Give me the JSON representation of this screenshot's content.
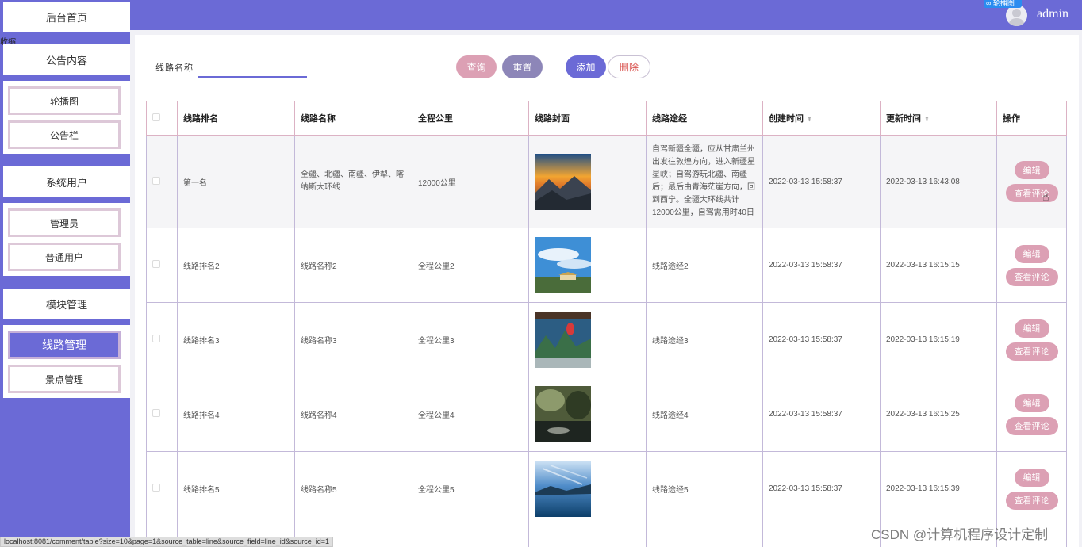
{
  "sidebar": {
    "home": "后台首页",
    "collapse": "收缩",
    "sections": [
      {
        "title": "公告内容",
        "items": [
          "轮播图",
          "公告栏"
        ]
      },
      {
        "title": "系统用户",
        "items": [
          "管理员",
          "普通用户"
        ]
      },
      {
        "title": "模块管理",
        "items": [
          "线路管理",
          "景点管理"
        ]
      }
    ],
    "active_item": "线路管理"
  },
  "header": {
    "username": "admin",
    "tray_badge": "∞ 轮播图"
  },
  "search": {
    "label": "线路名称",
    "placeholder": ""
  },
  "toolbar": {
    "query": "查询",
    "reset": "重置",
    "add": "添加",
    "delete": "删除"
  },
  "table": {
    "columns": [
      "线路排名",
      "线路名称",
      "全程公里",
      "线路封面",
      "线路途经",
      "创建时间",
      "更新时间",
      "操作"
    ],
    "rows": [
      {
        "rank": "第一名",
        "name": "全疆、北疆、南疆、伊犁、喀纳斯大环线",
        "distance": "12000公里",
        "route": "自驾新疆全疆，应从甘肃兰州出发往敦煌方向，进入新疆星星峡；自驾游玩北疆、南疆后；最后由青海茫崖方向，回到西宁。全疆大环线共计12000公里，自驾需用时40日",
        "created": "2022-03-13 15:58:37",
        "updated": "2022-03-13 16:43:08"
      },
      {
        "rank": "线路排名2",
        "name": "线路名称2",
        "distance": "全程公里2",
        "route": "线路途经2",
        "created": "2022-03-13 15:58:37",
        "updated": "2022-03-13 16:15:15"
      },
      {
        "rank": "线路排名3",
        "name": "线路名称3",
        "distance": "全程公里3",
        "route": "线路途经3",
        "created": "2022-03-13 15:58:37",
        "updated": "2022-03-13 16:15:19"
      },
      {
        "rank": "线路排名4",
        "name": "线路名称4",
        "distance": "全程公里4",
        "route": "线路途经4",
        "created": "2022-03-13 15:58:37",
        "updated": "2022-03-13 16:15:25"
      },
      {
        "rank": "线路排名5",
        "name": "线路名称5",
        "distance": "全程公里5",
        "route": "线路途经5",
        "created": "2022-03-13 15:58:37",
        "updated": "2022-03-13 16:15:39"
      }
    ],
    "actions": {
      "edit": "编辑",
      "view_comments": "查看评论"
    }
  },
  "statusbar": "localhost:8081/comment/table?size=10&page=1&source_table=line&source_field=line_id&source_id=1",
  "watermark": "CSDN @计算机程序设计定制",
  "colors": {
    "primary": "#6b6ad6",
    "pink": "#dca0b4",
    "gray_purple": "#8d86b8"
  }
}
